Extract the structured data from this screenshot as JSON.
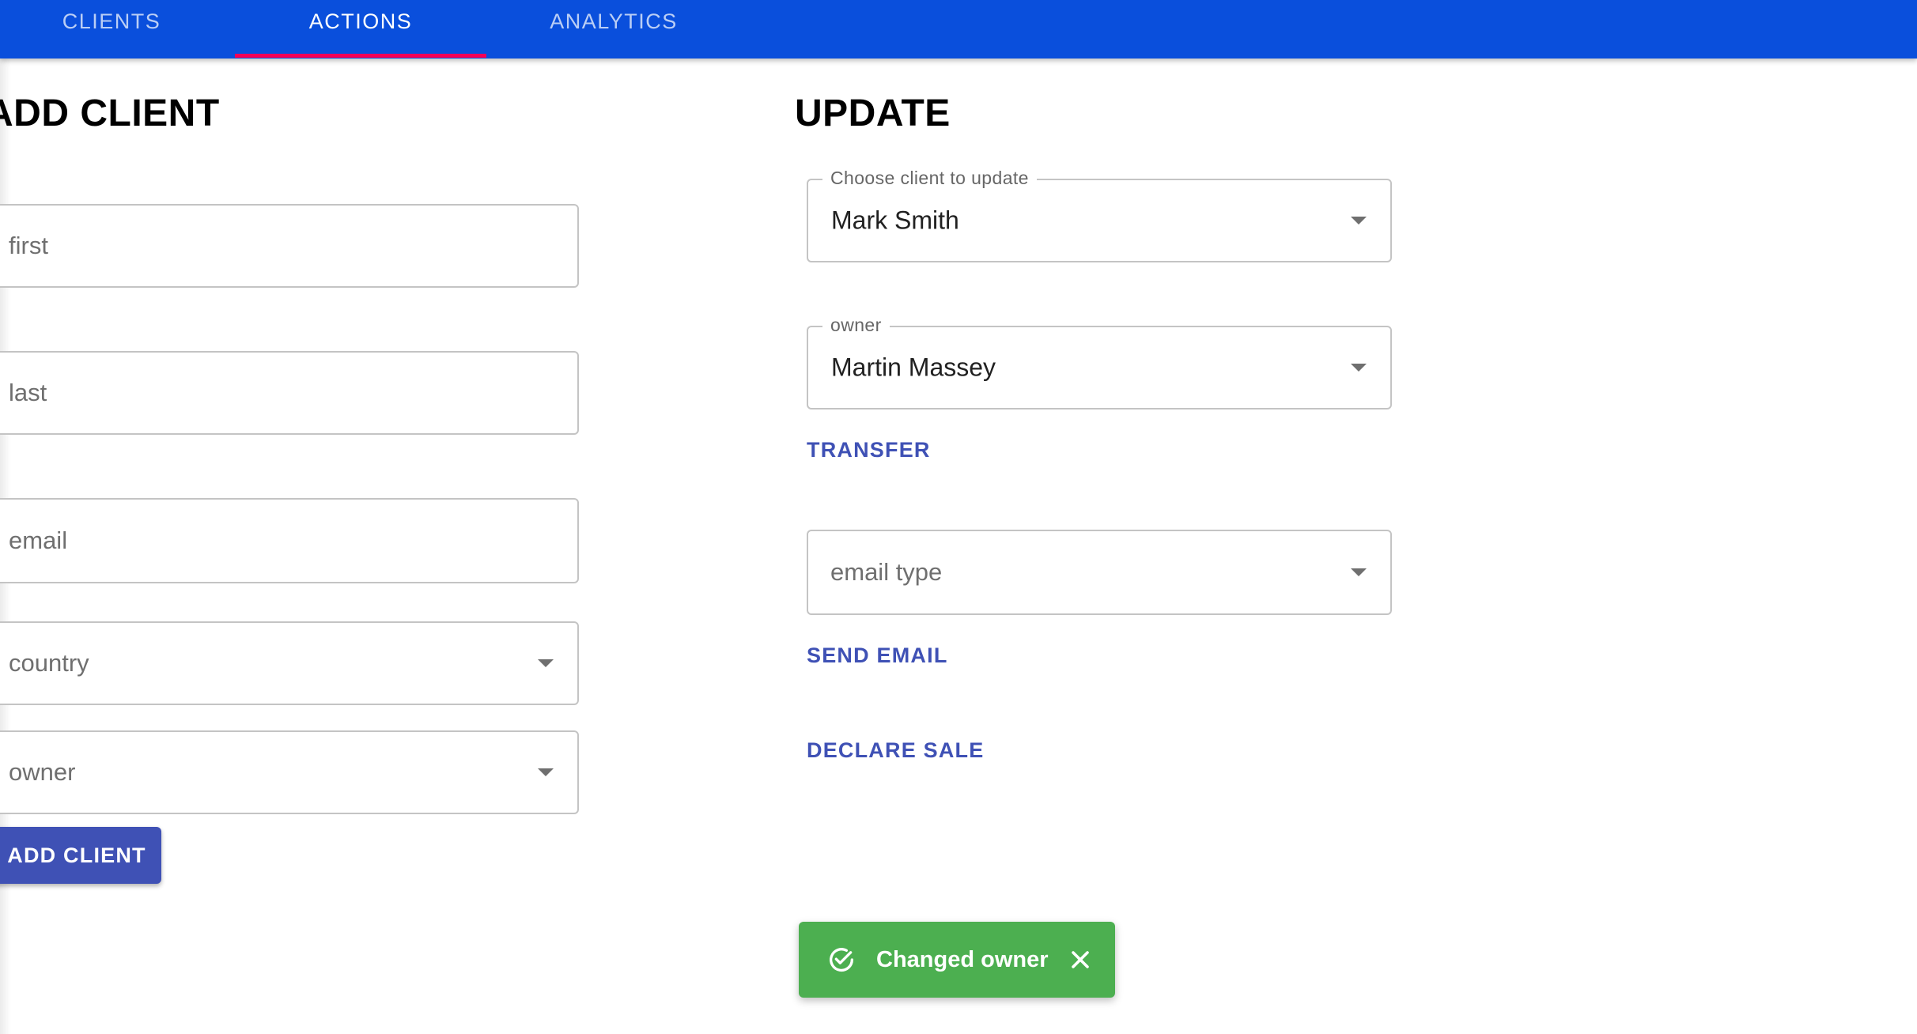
{
  "nav": {
    "tabs": [
      {
        "label": "CLIENTS"
      },
      {
        "label": "ACTIONS"
      },
      {
        "label": "ANALYTICS"
      }
    ],
    "active_tab": "ACTIONS",
    "bar_color": "#0a4fdc",
    "indicator_color": "#f50057"
  },
  "add_client": {
    "title": "ADD CLIENT",
    "first_placeholder": "first",
    "last_placeholder": "last",
    "email_placeholder": "email",
    "country_placeholder": "country",
    "owner_placeholder": "owner",
    "submit_label": "ADD CLIENT"
  },
  "update": {
    "title": "UPDATE",
    "client_select": {
      "label": "Choose client to update",
      "value": "Mark Smith"
    },
    "owner_select": {
      "label": "owner",
      "value": "Martin Massey"
    },
    "transfer_label": "TRANSFER",
    "email_type_placeholder": "email type",
    "send_email_label": "SEND EMAIL",
    "declare_sale_label": "DECLARE SALE",
    "accent_color": "#3f51b5"
  },
  "snackbar": {
    "message": "Changed owner",
    "color": "#4caf50",
    "icons": [
      "check-circle-icon",
      "close-icon"
    ]
  }
}
